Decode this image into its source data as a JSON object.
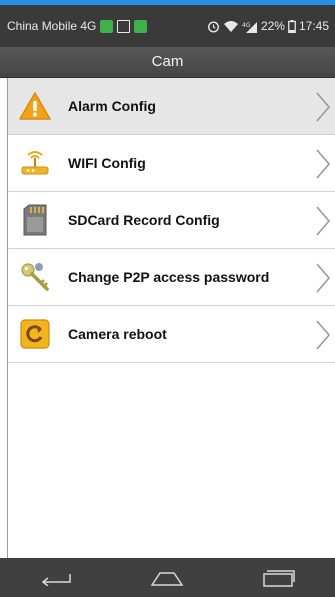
{
  "status_bar": {
    "carrier": "China Mobile 4G",
    "battery": "22%",
    "time": "17:45"
  },
  "header": {
    "title": "Cam"
  },
  "menu": {
    "items": [
      {
        "label": "Alarm Config",
        "icon": "warning-icon"
      },
      {
        "label": "WIFI Config",
        "icon": "wifi-router-icon"
      },
      {
        "label": "SDCard Record Config",
        "icon": "sd-card-icon"
      },
      {
        "label": "Change P2P access password",
        "icon": "key-icon"
      },
      {
        "label": "Camera reboot",
        "icon": "reboot-icon"
      }
    ]
  },
  "nav_bar": {
    "buttons": [
      "back-icon",
      "home-icon",
      "recent-apps-icon"
    ]
  },
  "colors": {
    "accent": "#2a8fe6",
    "status_bar": "#3a3a3a",
    "title_bar": "#4f4f4f",
    "nav_bar": "#404040"
  }
}
